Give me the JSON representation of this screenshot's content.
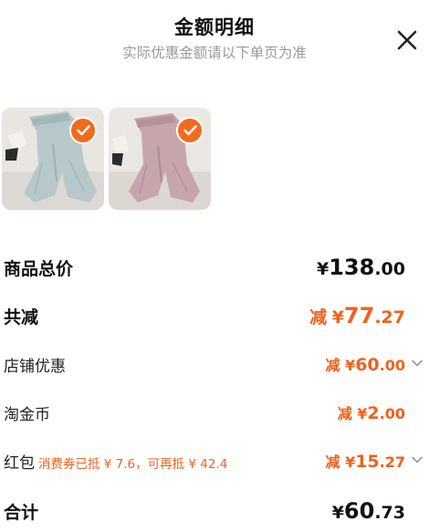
{
  "header": {
    "title": "金额明细",
    "subtitle": "实际优惠金额请以下单页为准"
  },
  "products": [
    {
      "name": "light-blue-pants",
      "selected": true,
      "color": "#bccccd"
    },
    {
      "name": "pink-pants",
      "selected": true,
      "color": "#c8a9ae"
    }
  ],
  "rows": {
    "total_price": {
      "label": "商品总价",
      "currency": "¥",
      "integer": "138",
      "decimal": ".00"
    },
    "total_discount": {
      "label": "共减",
      "prefix": "减",
      "currency": "¥",
      "integer": "77",
      "decimal": ".27"
    },
    "store_discount": {
      "label": "店铺优惠",
      "prefix": "减",
      "currency": "¥",
      "integer": "60",
      "decimal": ".00"
    },
    "taojinbi": {
      "label": "淘金币",
      "prefix": "减",
      "currency": "¥",
      "integer": "2",
      "decimal": ".00"
    },
    "red_packet": {
      "label": "红包",
      "note": "消费券已抵 ¥ 7.6，可再抵 ¥ 42.4",
      "prefix": "减",
      "currency": "¥",
      "integer": "15",
      "decimal": ".27"
    },
    "grand_total": {
      "label": "合计",
      "currency": "¥",
      "integer": "60",
      "decimal": ".73"
    }
  },
  "colors": {
    "accent": "#f0611e",
    "check": "#f26b1d",
    "subtitle": "#9a9a9a"
  },
  "icons": {
    "close": "close-icon",
    "check": "checkmark-icon",
    "expand": "chevron-down-icon"
  }
}
